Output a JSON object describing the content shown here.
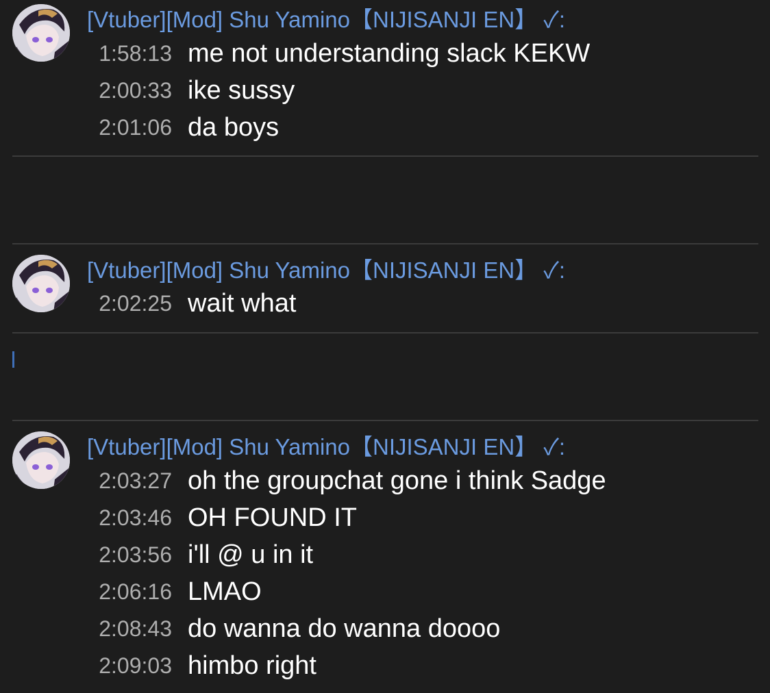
{
  "colors": {
    "background": "#1d1d1d",
    "author": "#6b9be0",
    "timestamp": "#aeaeae",
    "message": "#ffffff",
    "divider": "#3b3b3b"
  },
  "author_name": "[Vtuber][Mod] Shu Yamino【NIJISANJI EN】 ✓:",
  "groups": [
    {
      "author": "[Vtuber][Mod] Shu Yamino【NIJISANJI EN】 ✓:",
      "messages": [
        {
          "time": "1:58:13",
          "text": "me not understanding slack KEKW"
        },
        {
          "time": "2:00:33",
          "text": "ike sussy"
        },
        {
          "time": "2:01:06",
          "text": "da boys"
        }
      ]
    },
    {
      "author": "[Vtuber][Mod] Shu Yamino【NIJISANJI EN】 ✓:",
      "messages": [
        {
          "time": "2:02:25",
          "text": "wait what"
        }
      ]
    },
    {
      "author": "[Vtuber][Mod] Shu Yamino【NIJISANJI EN】 ✓:",
      "messages": [
        {
          "time": "2:03:27",
          "text": "oh the groupchat gone i think Sadge"
        },
        {
          "time": "2:03:46",
          "text": "OH FOUND IT"
        },
        {
          "time": "2:03:56",
          "text": "i'll @ u in it"
        },
        {
          "time": "2:06:16",
          "text": "LMAO"
        },
        {
          "time": "2:08:43",
          "text": "do wanna do wanna doooo"
        },
        {
          "time": "2:09:03",
          "text": "himbo right"
        }
      ]
    }
  ],
  "icons": {
    "avatar": "avatar-icon"
  }
}
